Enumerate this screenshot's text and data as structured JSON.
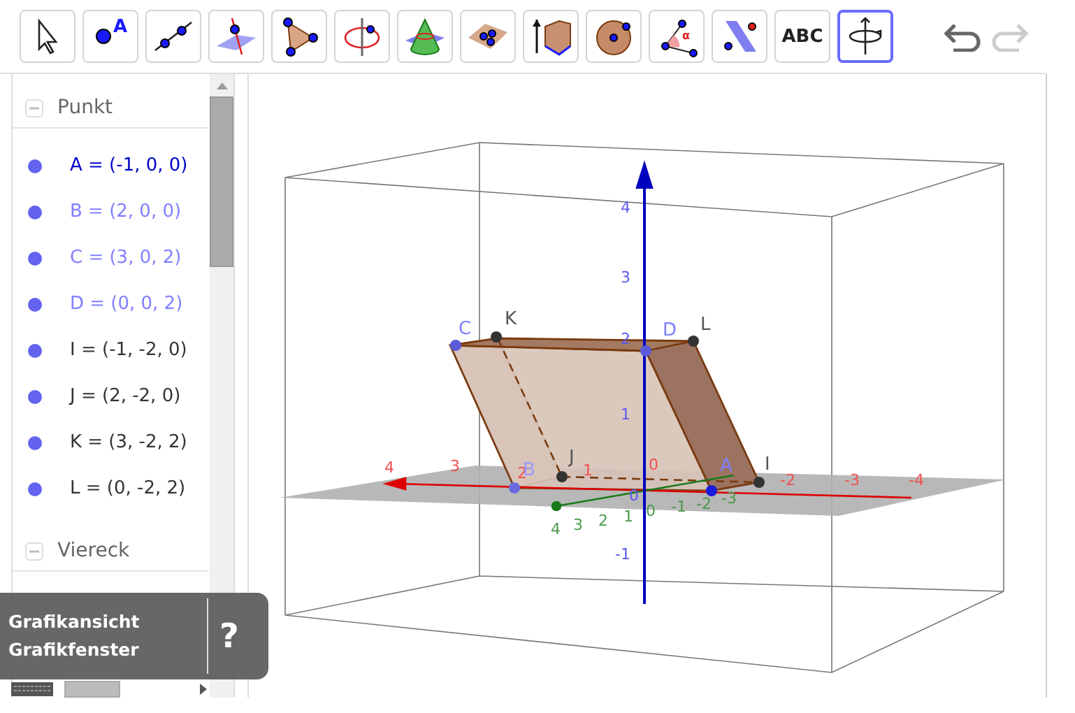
{
  "toolbar": {
    "tools": [
      {
        "kind": "move",
        "selected": false
      },
      {
        "kind": "point",
        "label": "A",
        "selected": false
      },
      {
        "kind": "line",
        "selected": false
      },
      {
        "kind": "perpendicular",
        "selected": false
      },
      {
        "kind": "polygon",
        "selected": false
      },
      {
        "kind": "circle-axis",
        "selected": false
      },
      {
        "kind": "cone",
        "selected": false
      },
      {
        "kind": "plane",
        "selected": false
      },
      {
        "kind": "prism",
        "selected": false
      },
      {
        "kind": "sphere",
        "selected": false
      },
      {
        "kind": "angle",
        "label": "α",
        "selected": false
      },
      {
        "kind": "reflect",
        "selected": false
      },
      {
        "kind": "text",
        "label": "ABC",
        "selected": false
      },
      {
        "kind": "rotate",
        "selected": true
      }
    ],
    "undo": {
      "disabled": false
    },
    "redo": {
      "disabled": true
    }
  },
  "algebra": {
    "groups": [
      {
        "title": "Punkt",
        "expanded": true,
        "items": [
          {
            "text": "A = (-1, 0, 0)",
            "color": "#0000cc"
          },
          {
            "text": "B = (2, 0, 0)",
            "color": "#8080ff"
          },
          {
            "text": "C = (3, 0, 2)",
            "color": "#8080ff"
          },
          {
            "text": "D = (0, 0, 2)",
            "color": "#8080ff"
          },
          {
            "text": "I = (-1, -2, 0)",
            "color": "#333333"
          },
          {
            "text": "J = (2, -2, 0)",
            "color": "#333333"
          },
          {
            "text": "K = (3, -2, 2)",
            "color": "#333333"
          },
          {
            "text": "L = (0, -2, 2)",
            "color": "#333333"
          }
        ]
      },
      {
        "title": "Viereck",
        "expanded": true
      }
    ]
  },
  "graphics": {
    "point_labels": [
      "C",
      "K",
      "D",
      "L",
      "B",
      "J",
      "A",
      "I"
    ],
    "x_ticks": [
      "4",
      "3",
      "2",
      "1",
      "0",
      "-2",
      "-3",
      "-4"
    ],
    "y_ticks": [
      "4",
      "3",
      "2",
      "1",
      "0",
      "-1",
      "-2",
      "-3"
    ],
    "z_ticks": [
      "4",
      "3",
      "2",
      "1",
      "0",
      "-1"
    ]
  },
  "tooltip": {
    "lines": [
      "Grafikansicht",
      "Grafikfenster"
    ],
    "help": "?"
  }
}
